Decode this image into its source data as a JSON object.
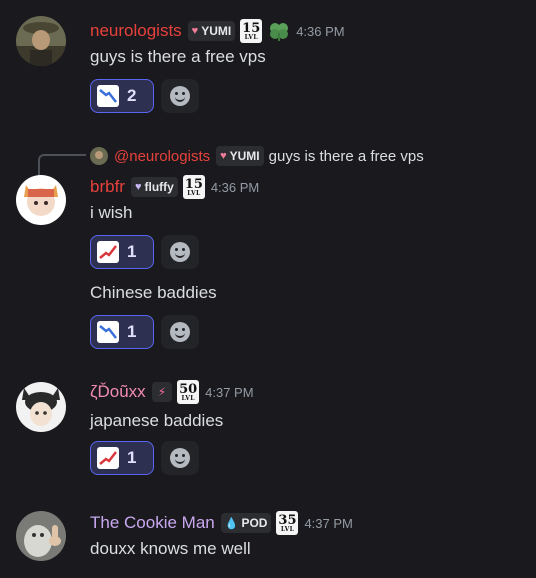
{
  "messages": [
    {
      "username": "neurologists",
      "name_color": "#e8413b",
      "tag": "YUMI",
      "tag_icon": "heart-icon",
      "level": "15",
      "level_label": "LVL",
      "extra_icon": "clover-icon",
      "time": "4:36 PM",
      "text": "guys is there a free vps",
      "reaction": {
        "emoji": "chart-decreasing-icon",
        "count": "2"
      }
    },
    {
      "reply": {
        "mention": "@neurologists",
        "tag": "YUMI",
        "text": "guys is there a free vps"
      },
      "username": "brbfr",
      "name_color": "#e8413b",
      "tag": "fluffy",
      "tag_icon": "heart-icon",
      "level": "15",
      "level_label": "LVL",
      "time": "4:36 PM",
      "text": "i wish",
      "reaction": {
        "emoji": "chart-increasing-icon",
        "count": "1"
      },
      "text2": "Chinese baddies",
      "reaction2": {
        "emoji": "chart-decreasing-icon",
        "count": "1"
      }
    },
    {
      "username": "ζĎoũxx",
      "name_color": "#f28cb1",
      "tag_icon": "lightning-icon",
      "level": "50",
      "level_label": "LVL",
      "time": "4:37 PM",
      "text": "japanese baddies",
      "reaction": {
        "emoji": "chart-increasing-icon",
        "count": "1"
      }
    },
    {
      "username": "The Cookie Man",
      "name_color": "#c9a8f0",
      "tag": "POD",
      "tag_icon": "droplet-icon",
      "level": "35",
      "level_label": "LVL",
      "time": "4:37 PM",
      "text": "douxx knows me well"
    }
  ]
}
